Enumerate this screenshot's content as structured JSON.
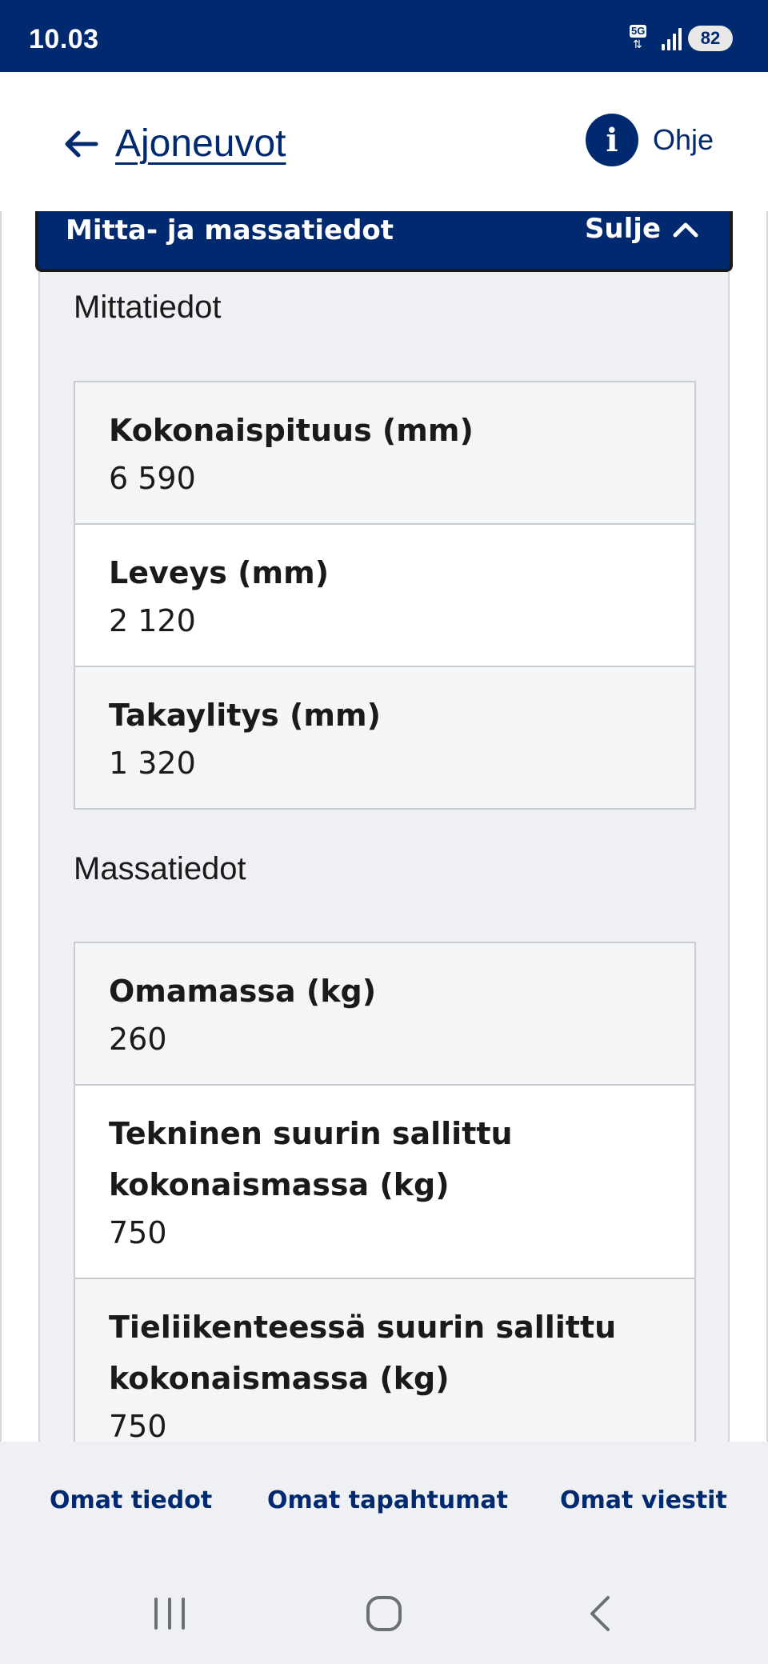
{
  "status_bar": {
    "time": "10.03",
    "network": "5G",
    "battery": "82"
  },
  "header": {
    "back_label": "Ajoneuvot",
    "help_label": "Ohje",
    "help_glyph": "i"
  },
  "accordion": {
    "title": "Mitta- ja massatiedot",
    "toggle_label": "Sulje",
    "sections": [
      {
        "title": "Mittatiedot",
        "fields": [
          {
            "label": "Kokonaispituus (mm)",
            "value": "6 590"
          },
          {
            "label": "Leveys (mm)",
            "value": "2 120"
          },
          {
            "label": "Takaylitys (mm)",
            "value": "1 320"
          }
        ]
      },
      {
        "title": "Massatiedot",
        "fields": [
          {
            "label": "Omamassa (kg)",
            "value": "260"
          },
          {
            "label": "Tekninen suurin sallittu kokonaismassa (kg)",
            "value": "750"
          },
          {
            "label": "Tieliikenteessä suurin sallittu kokonaismassa (kg)",
            "value": "750"
          }
        ]
      }
    ]
  },
  "bottom_tabs": [
    {
      "label": "Omat tiedot"
    },
    {
      "label": "Omat tapahtumat"
    },
    {
      "label": "Omat viestit"
    }
  ],
  "colors": {
    "brand": "#00296f",
    "panel_bg": "#eef0f4",
    "border": "#c9ccd2"
  },
  "icons": {
    "back": "arrow-left-icon",
    "help": "info-icon",
    "toggle": "chevron-up-icon",
    "nav_recents": "recents-icon",
    "nav_home": "home-icon",
    "nav_back": "back-icon"
  }
}
